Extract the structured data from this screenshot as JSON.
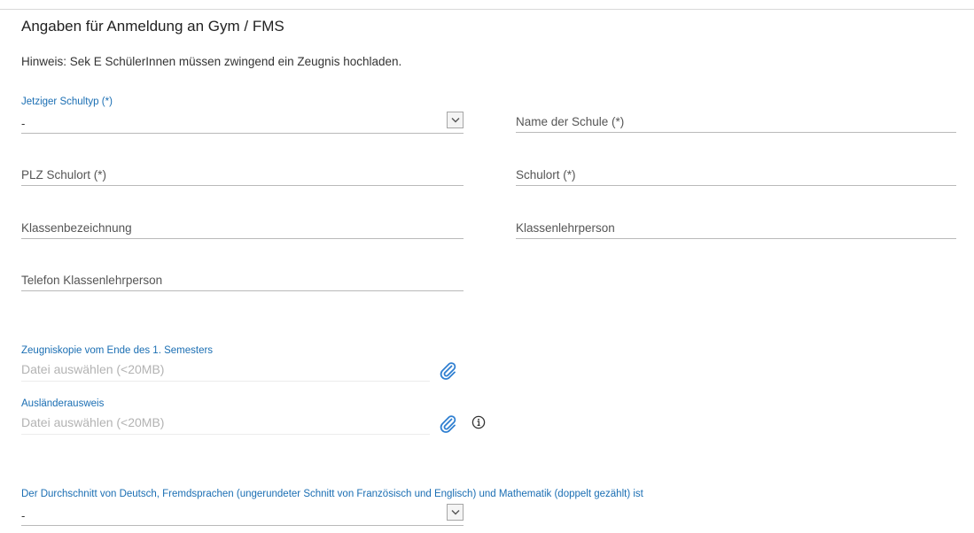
{
  "section": {
    "title": "Angaben für Anmeldung an Gym / FMS",
    "hint": "Hinweis: Sek E SchülerInnen müssen zwingend ein Zeugnis hochladen."
  },
  "fields": {
    "schultyp": {
      "label": "Jetziger Schultyp (*)",
      "value": "-"
    },
    "name_schule": {
      "placeholder": "Name der Schule (*)"
    },
    "plz": {
      "placeholder": "PLZ Schulort (*)"
    },
    "schulort": {
      "placeholder": "Schulort (*)"
    },
    "klassenbezeichnung": {
      "placeholder": "Klassenbezeichnung"
    },
    "klassenlehrperson": {
      "placeholder": "Klassenlehrperson"
    },
    "telefon": {
      "placeholder": "Telefon Klassenlehrperson"
    },
    "zeugnis": {
      "label": "Zeugniskopie vom Ende des 1. Semesters",
      "placeholder": "Datei auswählen (<20MB)"
    },
    "auslaenderausweis": {
      "label": "Ausländerausweis",
      "placeholder": "Datei auswählen (<20MB)"
    },
    "durchschnitt": {
      "label": "Der Durchschnitt von Deutsch, Fremdsprachen (ungerundeter Schnitt von Französisch und Englisch) und Mathematik (doppelt gezählt) ist",
      "value": "-"
    }
  },
  "icons": {
    "attach": "paperclip-icon",
    "info": "info-icon",
    "dropdown": "chevron-down-icon"
  },
  "colors": {
    "label_blue": "#1a6eb3",
    "icon_blue": "#2f7fd1"
  }
}
